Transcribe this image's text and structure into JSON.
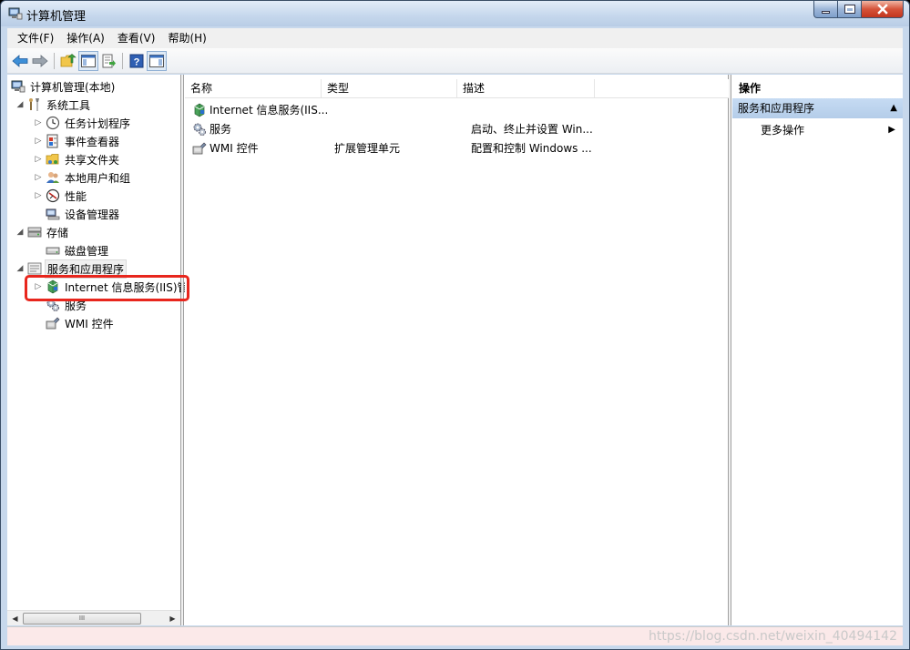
{
  "window": {
    "title": "计算机管理"
  },
  "menu": [
    {
      "label": "文件(F)"
    },
    {
      "label": "操作(A)"
    },
    {
      "label": "查看(V)"
    },
    {
      "label": "帮助(H)"
    }
  ],
  "toolbar": {
    "buttons": [
      "back-icon",
      "forward-icon",
      "up-folder-icon",
      "show-hide-tree-icon",
      "export-list-icon",
      "help-icon",
      "show-hide-action-pane-icon"
    ]
  },
  "tree": {
    "root": "计算机管理(本地)",
    "system_tools": "系统工具",
    "task_scheduler": "任务计划程序",
    "event_viewer": "事件查看器",
    "shared_folders": "共享文件夹",
    "local_users": "本地用户和组",
    "performance": "性能",
    "device_manager": "设备管理器",
    "storage": "存储",
    "disk_management": "磁盘管理",
    "services_apps": "服务和应用程序",
    "iis": "Internet 信息服务(IIS)管",
    "services": "服务",
    "wmi": "WMI 控件"
  },
  "list": {
    "columns": [
      "名称",
      "类型",
      "描述"
    ],
    "rows": [
      {
        "name": "Internet 信息服务(IIS...",
        "type": "",
        "desc": ""
      },
      {
        "name": "服务",
        "type": "",
        "desc": "启动、终止并设置 Win..."
      },
      {
        "name": "WMI 控件",
        "type": "扩展管理单元",
        "desc": "配置和控制 Windows ..."
      }
    ]
  },
  "actions": {
    "header": "操作",
    "section": "服务和应用程序",
    "more": "更多操作"
  },
  "scrollbar": {
    "thumb_grip": "III"
  },
  "watermark": "https://blog.csdn.net/weixin_40494142",
  "colors": {
    "highlight": "#e8261d",
    "action_section": "#c6dbf3"
  }
}
